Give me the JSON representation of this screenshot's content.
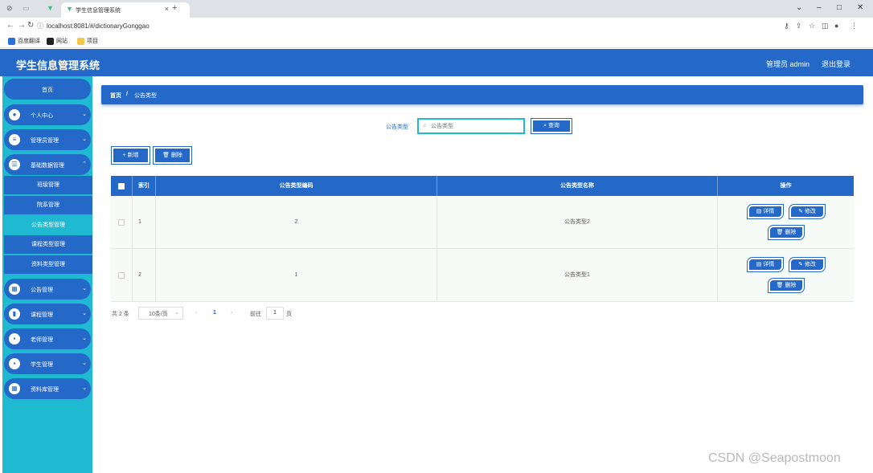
{
  "browser": {
    "tab_title": "学生信息管理系统",
    "url": "localhost:8081/#/dictionaryGonggao",
    "bookmarks": [
      "百度翻译",
      "网站",
      "项目"
    ]
  },
  "header": {
    "brand": "学生信息管理系统",
    "user": "管理员 admin",
    "logout": "退出登录"
  },
  "sidebar": {
    "home": "首页",
    "menus": [
      {
        "label": "个人中心"
      },
      {
        "label": "管理员管理"
      },
      {
        "label": "基础数据管理"
      }
    ],
    "submenus": [
      {
        "label": "班级管理"
      },
      {
        "label": "院系管理"
      },
      {
        "label": "公告类型管理"
      },
      {
        "label": "课程类型管理"
      },
      {
        "label": "资料类型管理"
      }
    ],
    "menus2": [
      {
        "label": "公告管理"
      },
      {
        "label": "课程管理"
      },
      {
        "label": "老师管理"
      },
      {
        "label": "学生管理"
      },
      {
        "label": "资料库管理"
      }
    ]
  },
  "breadcrumb": {
    "home": "首页",
    "separator": "/",
    "current": "公告类型"
  },
  "search": {
    "label": "公告类型",
    "placeholder": "公告类型",
    "button": "查询"
  },
  "toolbar": {
    "add": "+ 新增",
    "delete": "删除"
  },
  "table": {
    "headers": [
      "索引",
      "公告类型编码",
      "公告类型名称",
      "操作"
    ],
    "rows": [
      {
        "index": "1",
        "code": "2",
        "name": "公告类型2"
      },
      {
        "index": "2",
        "code": "1",
        "name": "公告类型1"
      }
    ],
    "actions": {
      "detail": "详情",
      "edit": "修改",
      "delete": "删除"
    }
  },
  "pagination": {
    "total": "共 2 条",
    "page_size": "10条/页",
    "current_page": "1",
    "goto_label": "前往",
    "goto_value": "1",
    "page_unit": "页"
  },
  "watermark": "CSDN @Seapostmoon",
  "colors": {
    "primary": "#2468c8",
    "sidebar": "#20b9d2"
  }
}
